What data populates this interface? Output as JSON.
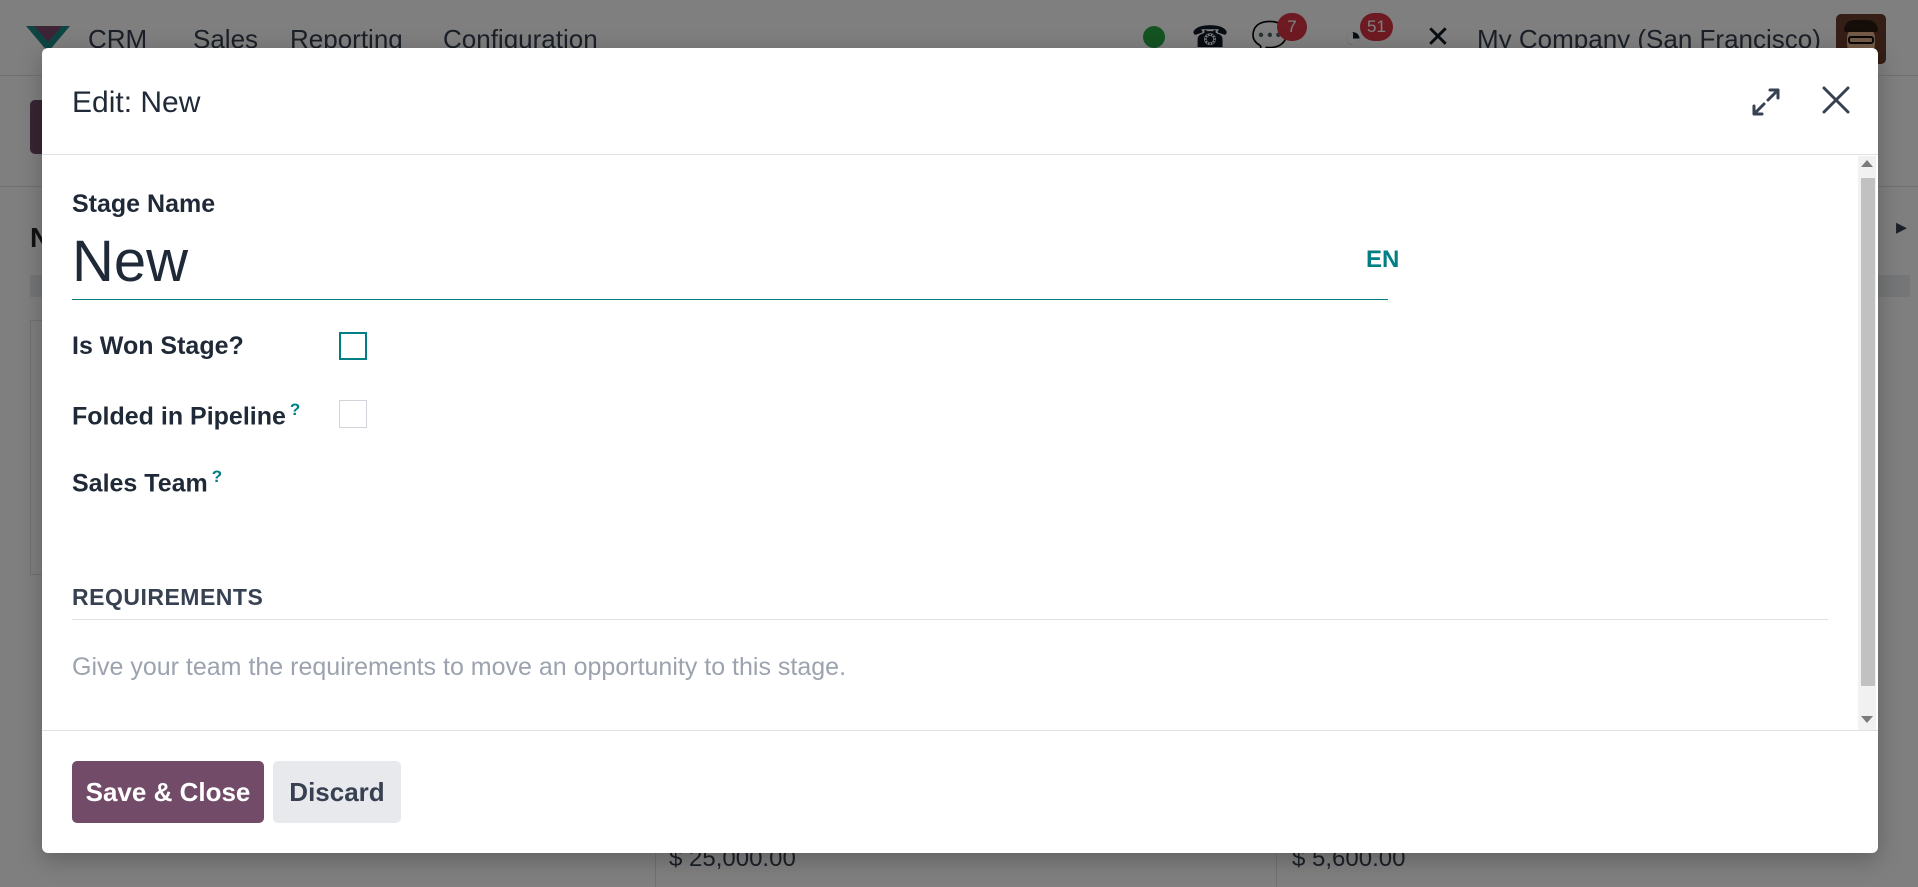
{
  "navbar": {
    "app_name": "CRM",
    "menus": [
      "Sales",
      "Reporting",
      "Configuration"
    ],
    "messages_badge": "7",
    "activities_badge": "51",
    "company": "My Company (San Francisco)"
  },
  "background": {
    "column_amounts": [
      "$ 25,000.00",
      "$ 5,600.00"
    ]
  },
  "dialog": {
    "title": "Edit: New",
    "fields": {
      "stage_name_label": "Stage Name",
      "stage_name_value": "New",
      "language_button": "EN",
      "is_won_label": "Is Won Stage?",
      "is_won_checked": false,
      "folded_label": "Folded in Pipeline",
      "folded_checked": false,
      "sales_team_label": "Sales Team",
      "help_mark": "?"
    },
    "requirements": {
      "section_title": "REQUIREMENTS",
      "placeholder": "Give your team the requirements to move an opportunity to this stage."
    },
    "footer": {
      "save_label": "Save & Close",
      "discard_label": "Discard"
    }
  }
}
